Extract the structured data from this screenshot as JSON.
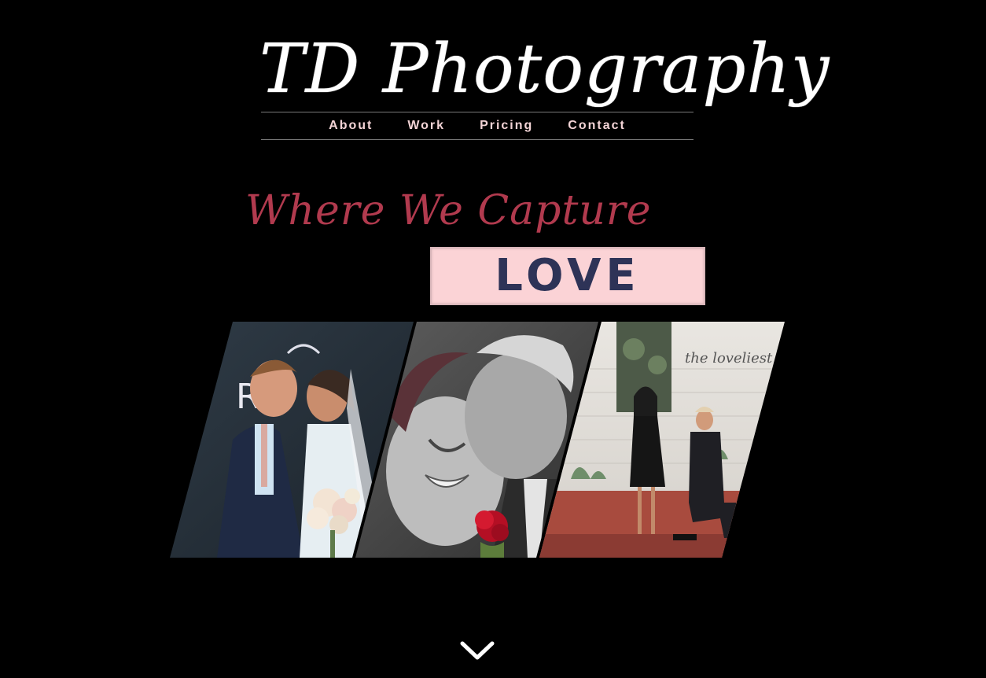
{
  "site": {
    "title": "TD Photography"
  },
  "nav": {
    "items": [
      {
        "label": "About"
      },
      {
        "label": "Work"
      },
      {
        "label": "Pricing"
      },
      {
        "label": "Contact"
      }
    ]
  },
  "hero": {
    "tagline": "Where We Capture",
    "highlight": "LOVE"
  },
  "gallery": {
    "photos": [
      {
        "name": "couple-embrace-photo",
        "sign_text": "R"
      },
      {
        "name": "couple-kiss-photo"
      },
      {
        "name": "proposal-photo",
        "sign_text": "the loveliest"
      }
    ]
  },
  "colors": {
    "background": "#000000",
    "nav_text": "#f3d4d6",
    "tagline": "#b13a4e",
    "love_box": "#fbd3d6",
    "love_text": "#2e3357"
  },
  "icons": {
    "scroll": "chevron-down-icon"
  }
}
